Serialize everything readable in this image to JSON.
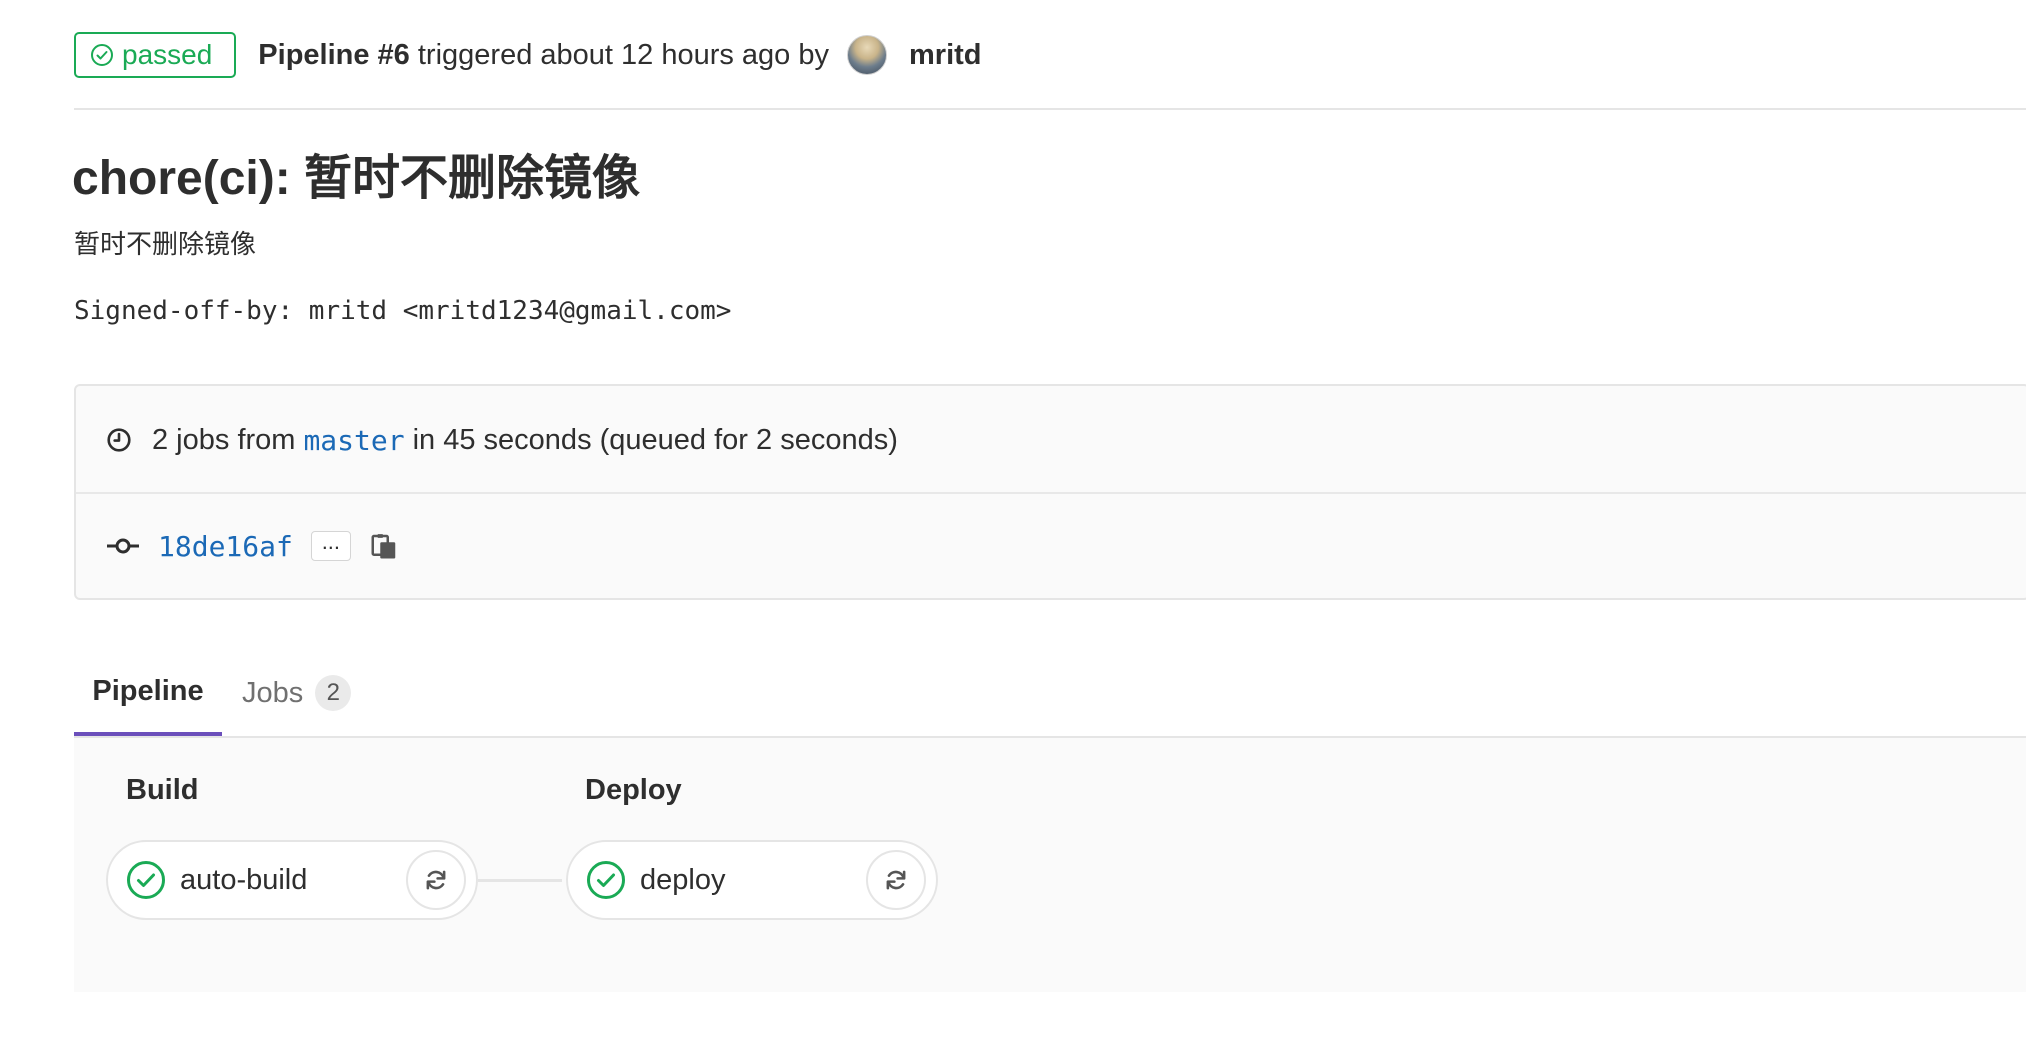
{
  "header": {
    "status": "passed",
    "pipeline_label": "Pipeline #6",
    "triggered_text": "triggered about 12 hours ago by",
    "author": "mritd"
  },
  "commit": {
    "title": "chore(ci): 暂时不删除镜像",
    "description": "暂时不删除镜像",
    "signoff": "Signed-off-by: mritd <mritd1234@gmail.com>"
  },
  "info": {
    "jobs_prefix": "2 jobs from",
    "branch": "master",
    "duration_text": "in 45 seconds (queued for 2 seconds)",
    "sha": "18de16af",
    "ellipsis": "..."
  },
  "tabs": {
    "pipeline": "Pipeline",
    "jobs": "Jobs",
    "jobs_count": "2"
  },
  "stages": [
    {
      "name": "Build",
      "job": "auto-build"
    },
    {
      "name": "Deploy",
      "job": "deploy"
    }
  ],
  "colors": {
    "success": "#1aaa55",
    "link": "#1b69b6",
    "active_tab": "#6b4fbb"
  },
  "icons": {
    "status": "check-circle-icon",
    "clock": "clock-icon",
    "commit": "commit-icon",
    "copy": "clipboard-icon",
    "retry": "retry-icon"
  }
}
